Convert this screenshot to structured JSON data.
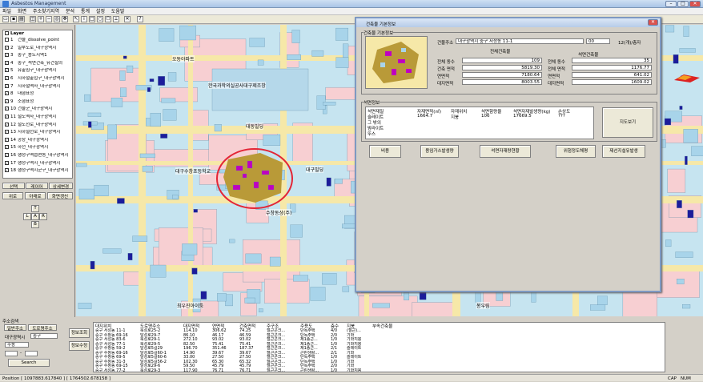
{
  "window": {
    "title": "Asbestos Management",
    "min": "–",
    "max": "□",
    "close": "✕"
  },
  "menu": [
    "파일",
    "화면",
    "주소찾기지역",
    "분석",
    "통계",
    "설정",
    "도움말"
  ],
  "toolbar_icons": [
    "open-icon",
    "save-icon",
    "print-icon",
    "layer-icon",
    "zoom-in-icon",
    "zoom-out-icon",
    "zoom-full-icon",
    "pan-icon",
    "select-icon",
    "identify-icon",
    "rectangle-icon",
    "circle-icon",
    "polygon-icon",
    "measure-icon",
    "clear-icon",
    "help-icon"
  ],
  "left": {
    "layer_header": "Layer",
    "layers": [
      {
        "n": "1",
        "label": "건물_dissolve_point",
        "checked": false
      },
      {
        "n": "2",
        "label": "일부도로_대구광역시",
        "checked": true
      },
      {
        "n": "3",
        "label": "중구_용도지역1",
        "checked": true
      },
      {
        "n": "4",
        "label": "중구_석면건축_유건실의",
        "checked": true
      },
      {
        "n": "5",
        "label": "유출임구_대구광역시",
        "checked": true
      },
      {
        "n": "6",
        "label": "지하철출입구_대구광역시",
        "checked": true
      },
      {
        "n": "7",
        "label": "지하철역사_대구광역시",
        "checked": true
      },
      {
        "n": "8",
        "label": "대형표정",
        "checked": true
      },
      {
        "n": "9",
        "label": "소형표정",
        "checked": true
      },
      {
        "n": "10",
        "label": "건물군_대구광역시",
        "checked": true
      },
      {
        "n": "11",
        "label": "철도역사_대구광역시",
        "checked": true
      },
      {
        "n": "12",
        "label": "철도선로_대구광역시",
        "checked": true
      },
      {
        "n": "13",
        "label": "지하철선로_대구광역시",
        "checked": true
      },
      {
        "n": "14",
        "label": "공장_대구광역시",
        "checked": true
      },
      {
        "n": "15",
        "label": "하천_대구광역시",
        "checked": true
      },
      {
        "n": "16",
        "label": "행정구역읍면동_대구광역시",
        "checked": true
      },
      {
        "n": "17",
        "label": "행정구역시_대구광역시",
        "checked": true
      },
      {
        "n": "18",
        "label": "행정구역시군구_대구광역시",
        "checked": true
      }
    ],
    "tabs": [
      "선택",
      "레이어",
      "상세변경"
    ],
    "buttons": [
      "위로",
      "아래로",
      "화면갱신"
    ],
    "nav": {
      "top": "T",
      "left": "L",
      "center": "A",
      "right": "R",
      "bottom": "B"
    },
    "search": {
      "title": "주소검색",
      "tab1": "일반주소",
      "tab2": "도로명주소",
      "city": "대구광역시",
      "district": "중구",
      "dong": "수동",
      "bunji": "-",
      "search_button": "Search",
      "info_button": "정보조회",
      "edit_button": "정보수정"
    }
  },
  "map": {
    "labels": [
      "오동아파트",
      "한국과학의실공사대구제조창",
      "대동빌딩",
      "대구수창초등학교",
      "대구빌딩",
      "수창동상(주)",
      "최우진아이툼",
      "봉우림"
    ]
  },
  "dialog": {
    "title": "건축물 기본정보",
    "group1": "건축물 기본정보",
    "addr_label": "건물주소",
    "addr_value": "대구광역시 중구 서성동 11-1",
    "addr_extra": "00",
    "count_label": "12(개)/층자",
    "left_title": "전체건축물",
    "right_title": "석면건축물",
    "rows": [
      {
        "l": "전체 동수",
        "lv": "109",
        "r": "전체 동수",
        "rv": "35"
      },
      {
        "l": "건축 면적",
        "lv": "5819.30",
        "r": "전체 면적",
        "rv": "1176.77"
      },
      {
        "l": "연면적",
        "lv": "7180.64",
        "r": "연면적",
        "rv": "641.02"
      },
      {
        "l": "대지면적",
        "lv": "8003.55",
        "r": "대지면적",
        "rv": "1609.02"
      }
    ],
    "group2": "석면정보",
    "table_headers": [
      "석면재질",
      "자재면적(㎡)",
      "자재위치",
      "석면함량율",
      "석면자재발생량(kg)",
      "손상도"
    ],
    "table_row": [
      "슬레이트",
      "1664.7",
      "지붕",
      "106",
      "17669.5",
      "???"
    ],
    "materials": [
      "슬레이트",
      "그 밖의",
      "밤라이트",
      "뚜스"
    ],
    "side_button": "지도보기",
    "buttons": [
      "비용",
      "용임가스발생량",
      "석면자재량현황",
      "위험정도해평",
      "제선지설유발생"
    ]
  },
  "bottom": {
    "headers": [
      "대지위치",
      "도로명주소",
      "대지면적",
      "연면적",
      "건축면적",
      "주구조",
      "주용도",
      "층수",
      "지붕",
      "부속건축물"
    ],
    "rows": [
      [
        "중구 서성동 11-1",
        "북성로25-2",
        "114.10",
        "306.62",
        "74.25",
        "철근콘크...",
        "단독주택",
        "4/0",
        "(철근)...",
        ""
      ],
      [
        "중구 수창동 69-16",
        "달성로29-7",
        "86.10",
        "46.17",
        "46.59",
        "철근콘크...",
        "단독주택",
        "2/0",
        "기와",
        ""
      ],
      [
        "중구 서성동 83-6",
        "북성로29-1",
        "272.10",
        "93.02",
        "93.02",
        "철근콘크...",
        "제1종근...",
        "1/0",
        "기와지붕",
        ""
      ],
      [
        "중구 서성동 77-1",
        "북성로29-5",
        "82.50",
        "75.41",
        "75.41",
        "철근콘크...",
        "제1종근...",
        "1/0",
        "기와지붕",
        ""
      ],
      [
        "중구 수창동 59-2",
        "달성로5길29",
        "196.70",
        "351.46",
        "187.37",
        "철근콘크...",
        "제1종근...",
        "2/1",
        "슬레이트",
        ""
      ],
      [
        "중구 수창동 69-16",
        "달성로5길60-1",
        "14.90",
        "39.67",
        "39.67",
        "철근콘크...",
        "근린생활...",
        "2/1",
        "기와",
        ""
      ],
      [
        "중구 수창동 69-5",
        "달성로5길60-6",
        "33.00",
        "27.50",
        "27.50",
        "철근콘크...",
        "단독주택",
        "1/0",
        "슬레이트",
        ""
      ],
      [
        "중구 수창동 31-3",
        "달성로5길56-2",
        "102.30",
        "65.30",
        "65.32",
        "철근콘크...",
        "단독주택",
        "1/0",
        "기와",
        ""
      ],
      [
        "중구 수창동 69-15",
        "달성로29-6",
        "59.50",
        "45.79",
        "45.79",
        "철근콘크...",
        "단독주택",
        "2/0",
        "기와",
        ""
      ],
      [
        "중구 서성동 77-2",
        "북성로29-3",
        "117.90",
        "76.71",
        "76.71",
        "철근콘크...",
        "근린생활...",
        "1/0",
        "기와지붕",
        ""
      ]
    ]
  },
  "status": {
    "position": "Position [ 1097883.617840 ] [ 1764502.678158 ]",
    "cap": "CAP",
    "num": "NUM"
  },
  "colors": {
    "accent": "#e32636",
    "building": "#a8d4ea",
    "parcel": "#f7cfd2",
    "road": "#f6e8a8",
    "asbestos": "#c000c0",
    "navy": "#1c1c9a",
    "zone": "#b99a38"
  }
}
